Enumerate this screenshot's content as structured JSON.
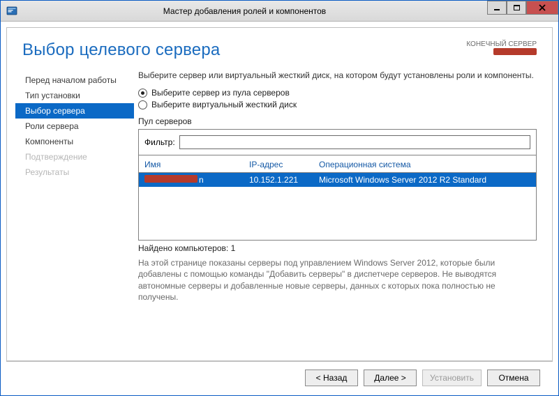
{
  "window": {
    "title": "Мастер добавления ролей и компонентов"
  },
  "header": {
    "heading": "Выбор целевого сервера",
    "dest_label": "КОНЕЧНЫЙ СЕРВЕР"
  },
  "sidebar": {
    "items": [
      {
        "label": "Перед началом работы",
        "state": "normal"
      },
      {
        "label": "Тип установки",
        "state": "normal"
      },
      {
        "label": "Выбор сервера",
        "state": "active"
      },
      {
        "label": "Роли сервера",
        "state": "normal"
      },
      {
        "label": "Компоненты",
        "state": "normal"
      },
      {
        "label": "Подтверждение",
        "state": "disabled"
      },
      {
        "label": "Результаты",
        "state": "disabled"
      }
    ]
  },
  "content": {
    "prompt": "Выберите сервер или виртуальный жесткий диск, на котором будут установлены роли и компоненты.",
    "radio": {
      "pool": "Выберите сервер из пула серверов",
      "vhd": "Выберите виртуальный жесткий диск",
      "selected": "pool"
    },
    "pool_label": "Пул серверов",
    "filter_label": "Фильтр:",
    "filter_value": "",
    "columns": {
      "name": "Имя",
      "ip": "IP-адрес",
      "os": "Операционная система"
    },
    "rows": [
      {
        "name_suffix": "n",
        "ip": "10.152.1.221",
        "os": "Microsoft Windows Server 2012 R2 Standard"
      }
    ],
    "found_line": "Найдено компьютеров: 1",
    "explain": "На этой странице показаны серверы под управлением Windows Server 2012, которые были добавлены с помощью команды \"Добавить серверы\" в диспетчере серверов. Не выводятся автономные серверы и добавленные новые серверы, данных с которых пока полностью не получены."
  },
  "footer": {
    "prev": "< Назад",
    "next": "Далее >",
    "install": "Установить",
    "cancel": "Отмена"
  }
}
